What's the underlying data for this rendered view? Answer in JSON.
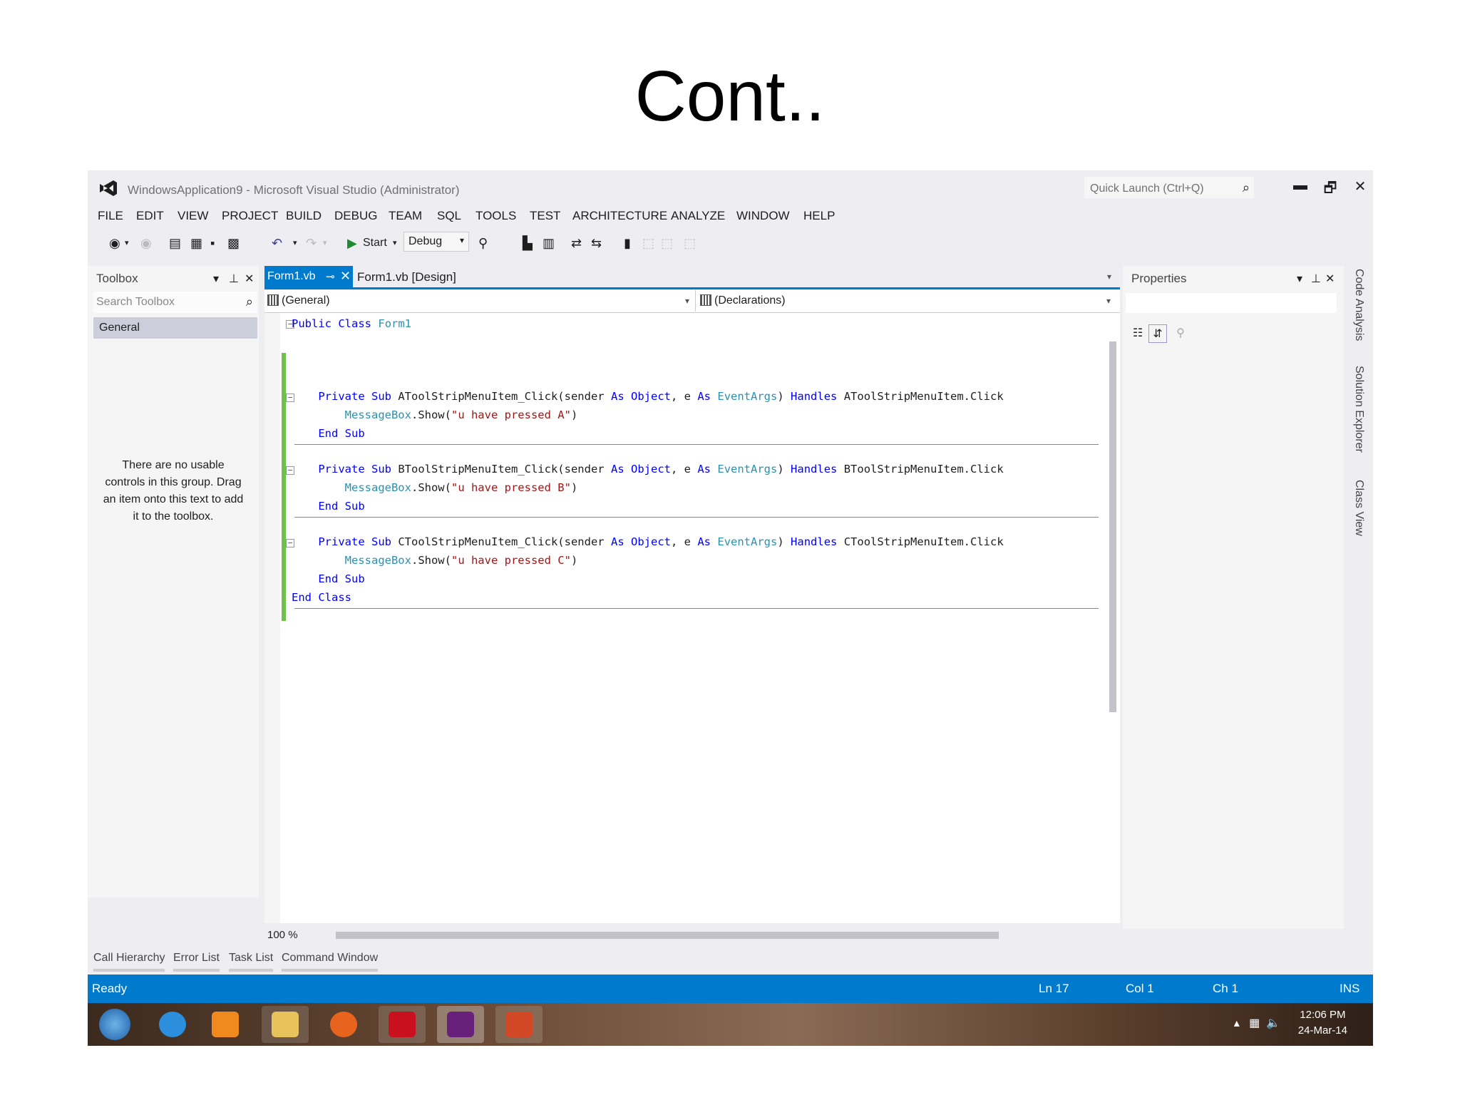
{
  "slide": {
    "title": "Cont.."
  },
  "window": {
    "title": "WindowsApplication9 - Microsoft Visual Studio (Administrator)",
    "quick_launch_placeholder": "Quick Launch (Ctrl+Q)",
    "minimize": "▬",
    "restore": "🗗",
    "close": "✕"
  },
  "menu": [
    "FILE",
    "EDIT",
    "VIEW",
    "PROJECT",
    "BUILD",
    "DEBUG",
    "TEAM",
    "SQL",
    "TOOLS",
    "TEST",
    "ARCHITECTURE",
    "ANALYZE",
    "WINDOW",
    "HELP"
  ],
  "toolbar": {
    "start_label": "Start",
    "config": "Debug"
  },
  "toolbox": {
    "title": "Toolbox",
    "search_placeholder": "Search Toolbox",
    "group": "General",
    "empty_message": "There are no usable controls in this group. Drag an item onto this text to add it to the toolbox."
  },
  "tabs": {
    "active": "Form1.vb",
    "second": "Form1.vb [Design]"
  },
  "navbar": {
    "left": "(General)",
    "right": "(Declarations)"
  },
  "code": {
    "class_open": [
      "Public",
      "Class",
      "Form1"
    ],
    "subs": [
      {
        "private": "Private",
        "sub": "Sub",
        "name": "AToolStripMenuItem_Click(sender",
        "as1": "As",
        "obj": "Object",
        "e": ", e",
        "as2": "As",
        "eargs": "EventArgs",
        "handles": "Handles",
        "target": "AToolStripMenuItem.Click",
        "msgbox": "MessageBox",
        "show": ".Show(",
        "str": "\"u have pressed A\"",
        "close": ")",
        "end": "End",
        "endsub": "Sub"
      },
      {
        "private": "Private",
        "sub": "Sub",
        "name": "BToolStripMenuItem_Click(sender",
        "as1": "As",
        "obj": "Object",
        "e": ", e",
        "as2": "As",
        "eargs": "EventArgs",
        "handles": "Handles",
        "target": "BToolStripMenuItem.Click",
        "msgbox": "MessageBox",
        "show": ".Show(",
        "str": "\"u have pressed B\"",
        "close": ")",
        "end": "End",
        "endsub": "Sub"
      },
      {
        "private": "Private",
        "sub": "Sub",
        "name": "CToolStripMenuItem_Click(sender",
        "as1": "As",
        "obj": "Object",
        "e": ", e",
        "as2": "As",
        "eargs": "EventArgs",
        "handles": "Handles",
        "target": "CToolStripMenuItem.Click",
        "msgbox": "MessageBox",
        "show": ".Show(",
        "str": "\"u have pressed C\"",
        "close": ")",
        "end": "End",
        "endsub": "Sub"
      }
    ],
    "class_close": [
      "End",
      "Class"
    ]
  },
  "editor": {
    "zoom": "100 %"
  },
  "properties": {
    "title": "Properties"
  },
  "side_tabs": [
    "Code Analysis",
    "Solution Explorer",
    "Class View"
  ],
  "bottom_tabs": [
    "Call Hierarchy",
    "Error List",
    "Task List",
    "Command Window"
  ],
  "status": {
    "ready": "Ready",
    "line": "Ln 17",
    "col": "Col 1",
    "ch": "Ch 1",
    "mode": "INS"
  },
  "taskbar": {
    "time": "12:06 PM",
    "date": "24-Mar-14"
  },
  "colors": {
    "accent": "#007acc",
    "keyword": "#0000ff",
    "type": "#2b91af",
    "string": "#a31515",
    "changebar": "#6cc24a"
  }
}
